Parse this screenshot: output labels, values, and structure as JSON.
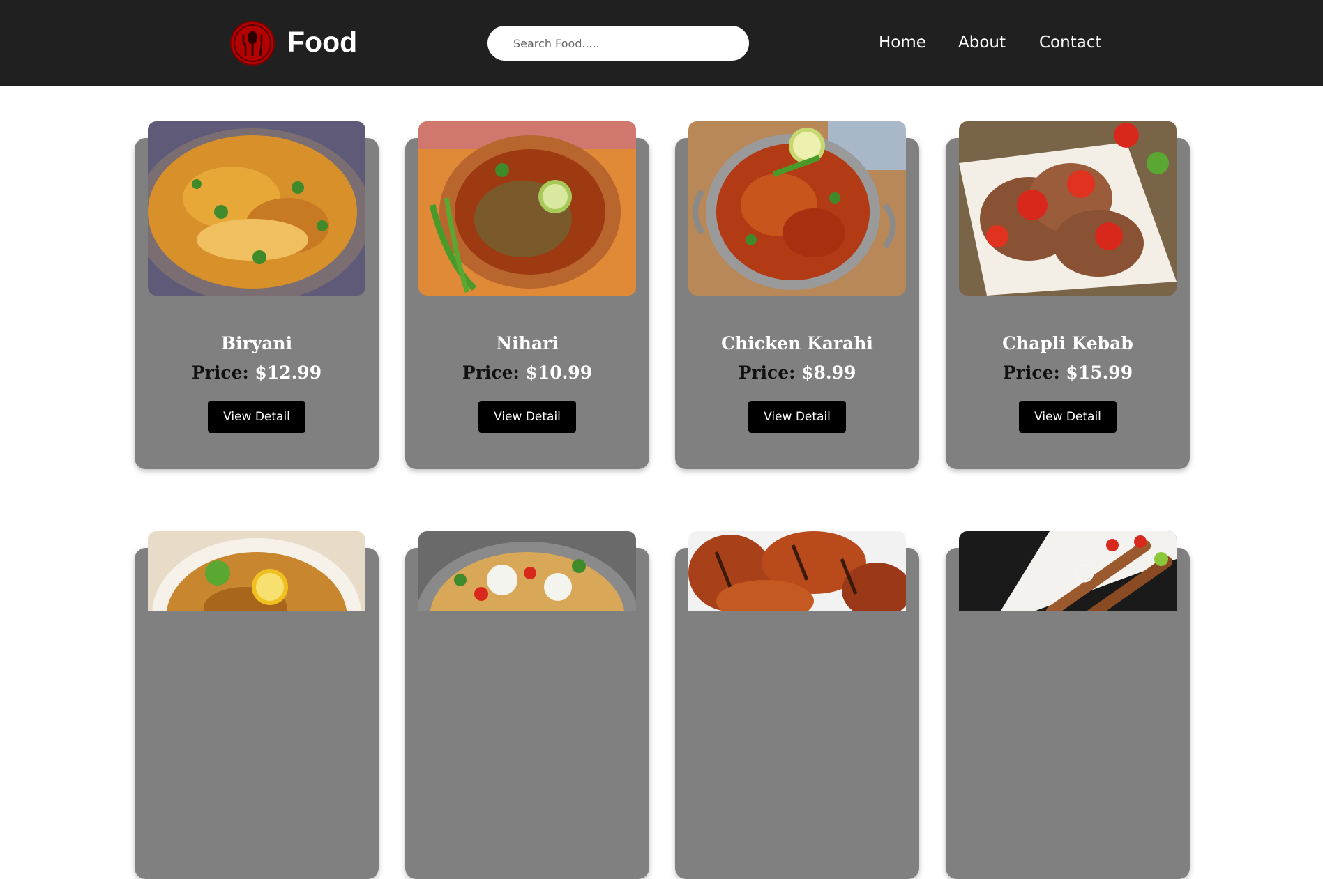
{
  "header": {
    "logo_icon": "chef-spoon-icon",
    "brand": "Food",
    "search": {
      "placeholder": "Search Food.....",
      "value": ""
    },
    "nav": [
      {
        "label": "Home"
      },
      {
        "label": "About"
      },
      {
        "label": "Contact"
      }
    ]
  },
  "cards": [
    {
      "name": "Biryani",
      "price_label": "Price:",
      "price": "$12.99",
      "button": "View Detail",
      "image": "biryani-image"
    },
    {
      "name": "Nihari",
      "price_label": "Price:",
      "price": "$10.99",
      "button": "View Detail",
      "image": "nihari-image"
    },
    {
      "name": "Chicken Karahi",
      "price_label": "Price:",
      "price": "$8.99",
      "button": "View Detail",
      "image": "chicken-karahi-image"
    },
    {
      "name": "Chapli Kebab",
      "price_label": "Price:",
      "price": "$15.99",
      "button": "View Detail",
      "image": "chapli-kebab-image"
    },
    {
      "image": "haleem-image"
    },
    {
      "image": "chaat-image"
    },
    {
      "image": "tandoori-chicken-image"
    },
    {
      "image": "seekh-kebab-image"
    }
  ],
  "colors": {
    "header_bg": "#202020",
    "card_bg": "#808080",
    "button_bg": "#000000",
    "logo": "#b30000"
  }
}
